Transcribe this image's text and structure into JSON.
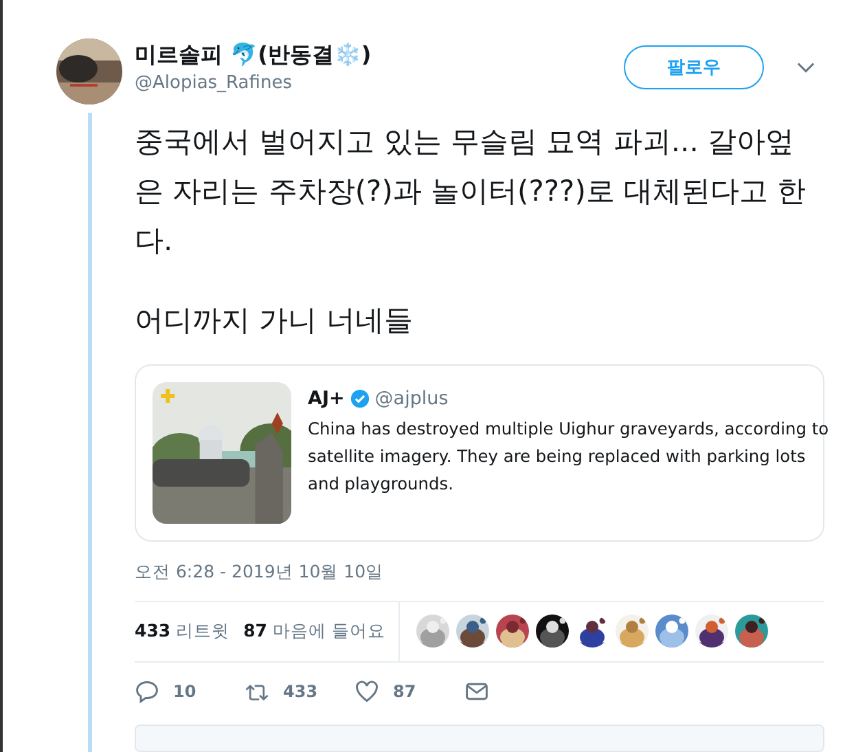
{
  "author": {
    "name": "미르솔피 🐬(반동결❄️)",
    "handle": "@Alopias_Rafines"
  },
  "follow_button": "팔로우",
  "tweet_text": [
    "중국에서 벌어지고 있는 무슬림 묘역 파괴...  갈아엎은 자리는 주차장(?)과 놀이터(???)로 대체된다고 한다.",
    "어디까지 가니 너네들"
  ],
  "quoted": {
    "name": "AJ+",
    "verified": true,
    "handle": "@ajplus",
    "text": "China has destroyed multiple Uighur graveyards, according to satellite imagery. They are being replaced with parking lots and playgrounds."
  },
  "timestamp": "오전 6:28 - 2019년 10월 10일",
  "stats": [
    {
      "count": "433",
      "label": "리트윗"
    },
    {
      "count": "87",
      "label": "마음에 들어요"
    }
  ],
  "actions": [
    {
      "kind": "reply",
      "count": "10"
    },
    {
      "kind": "retweet",
      "count": "433"
    },
    {
      "kind": "like",
      "count": "87"
    },
    {
      "kind": "message"
    }
  ]
}
